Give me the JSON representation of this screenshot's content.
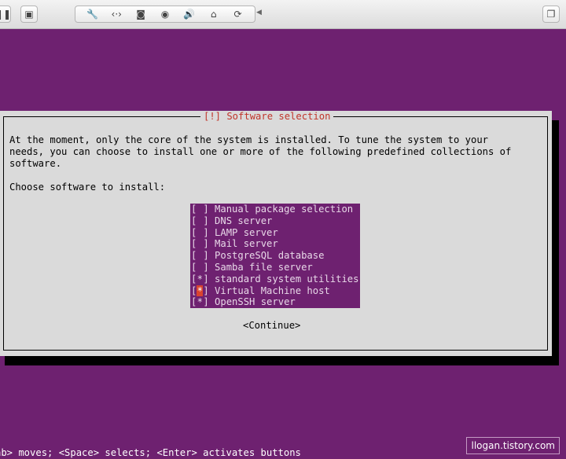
{
  "toolbar": {
    "icons": [
      "pause-icon",
      "snapshot-icon",
      "wrench-icon",
      "network-icon",
      "disk-icon",
      "camera-icon",
      "speaker-icon",
      "usb-icon",
      "refresh-icon",
      "restore-icon"
    ]
  },
  "dialog": {
    "title": "[!] Software selection",
    "intro_lines": [
      "At the moment, only the core of the system is installed. To tune the system to your",
      "needs, you can choose to install one or more of the following predefined collections of",
      "software."
    ],
    "prompt": "Choose software to install:",
    "items": [
      {
        "label": "Manual package selection",
        "checked": false
      },
      {
        "label": "DNS server",
        "checked": false
      },
      {
        "label": "LAMP server",
        "checked": false
      },
      {
        "label": "Mail server",
        "checked": false
      },
      {
        "label": "PostgreSQL database",
        "checked": false
      },
      {
        "label": "Samba file server",
        "checked": false
      },
      {
        "label": "standard system utilities",
        "checked": true
      },
      {
        "label": "Virtual Machine host",
        "checked": true,
        "focused": true
      },
      {
        "label": "OpenSSH server",
        "checked": true
      }
    ],
    "continue_label": "<Continue>"
  },
  "footer": {
    "help": "ab> moves; <Space> selects; <Enter> activates buttons",
    "watermark": "llogan.tistory.com"
  },
  "colors": {
    "background": "#6e2170",
    "dialog": "#dadada",
    "title": "#c1352b",
    "focus": "#d9432f"
  }
}
